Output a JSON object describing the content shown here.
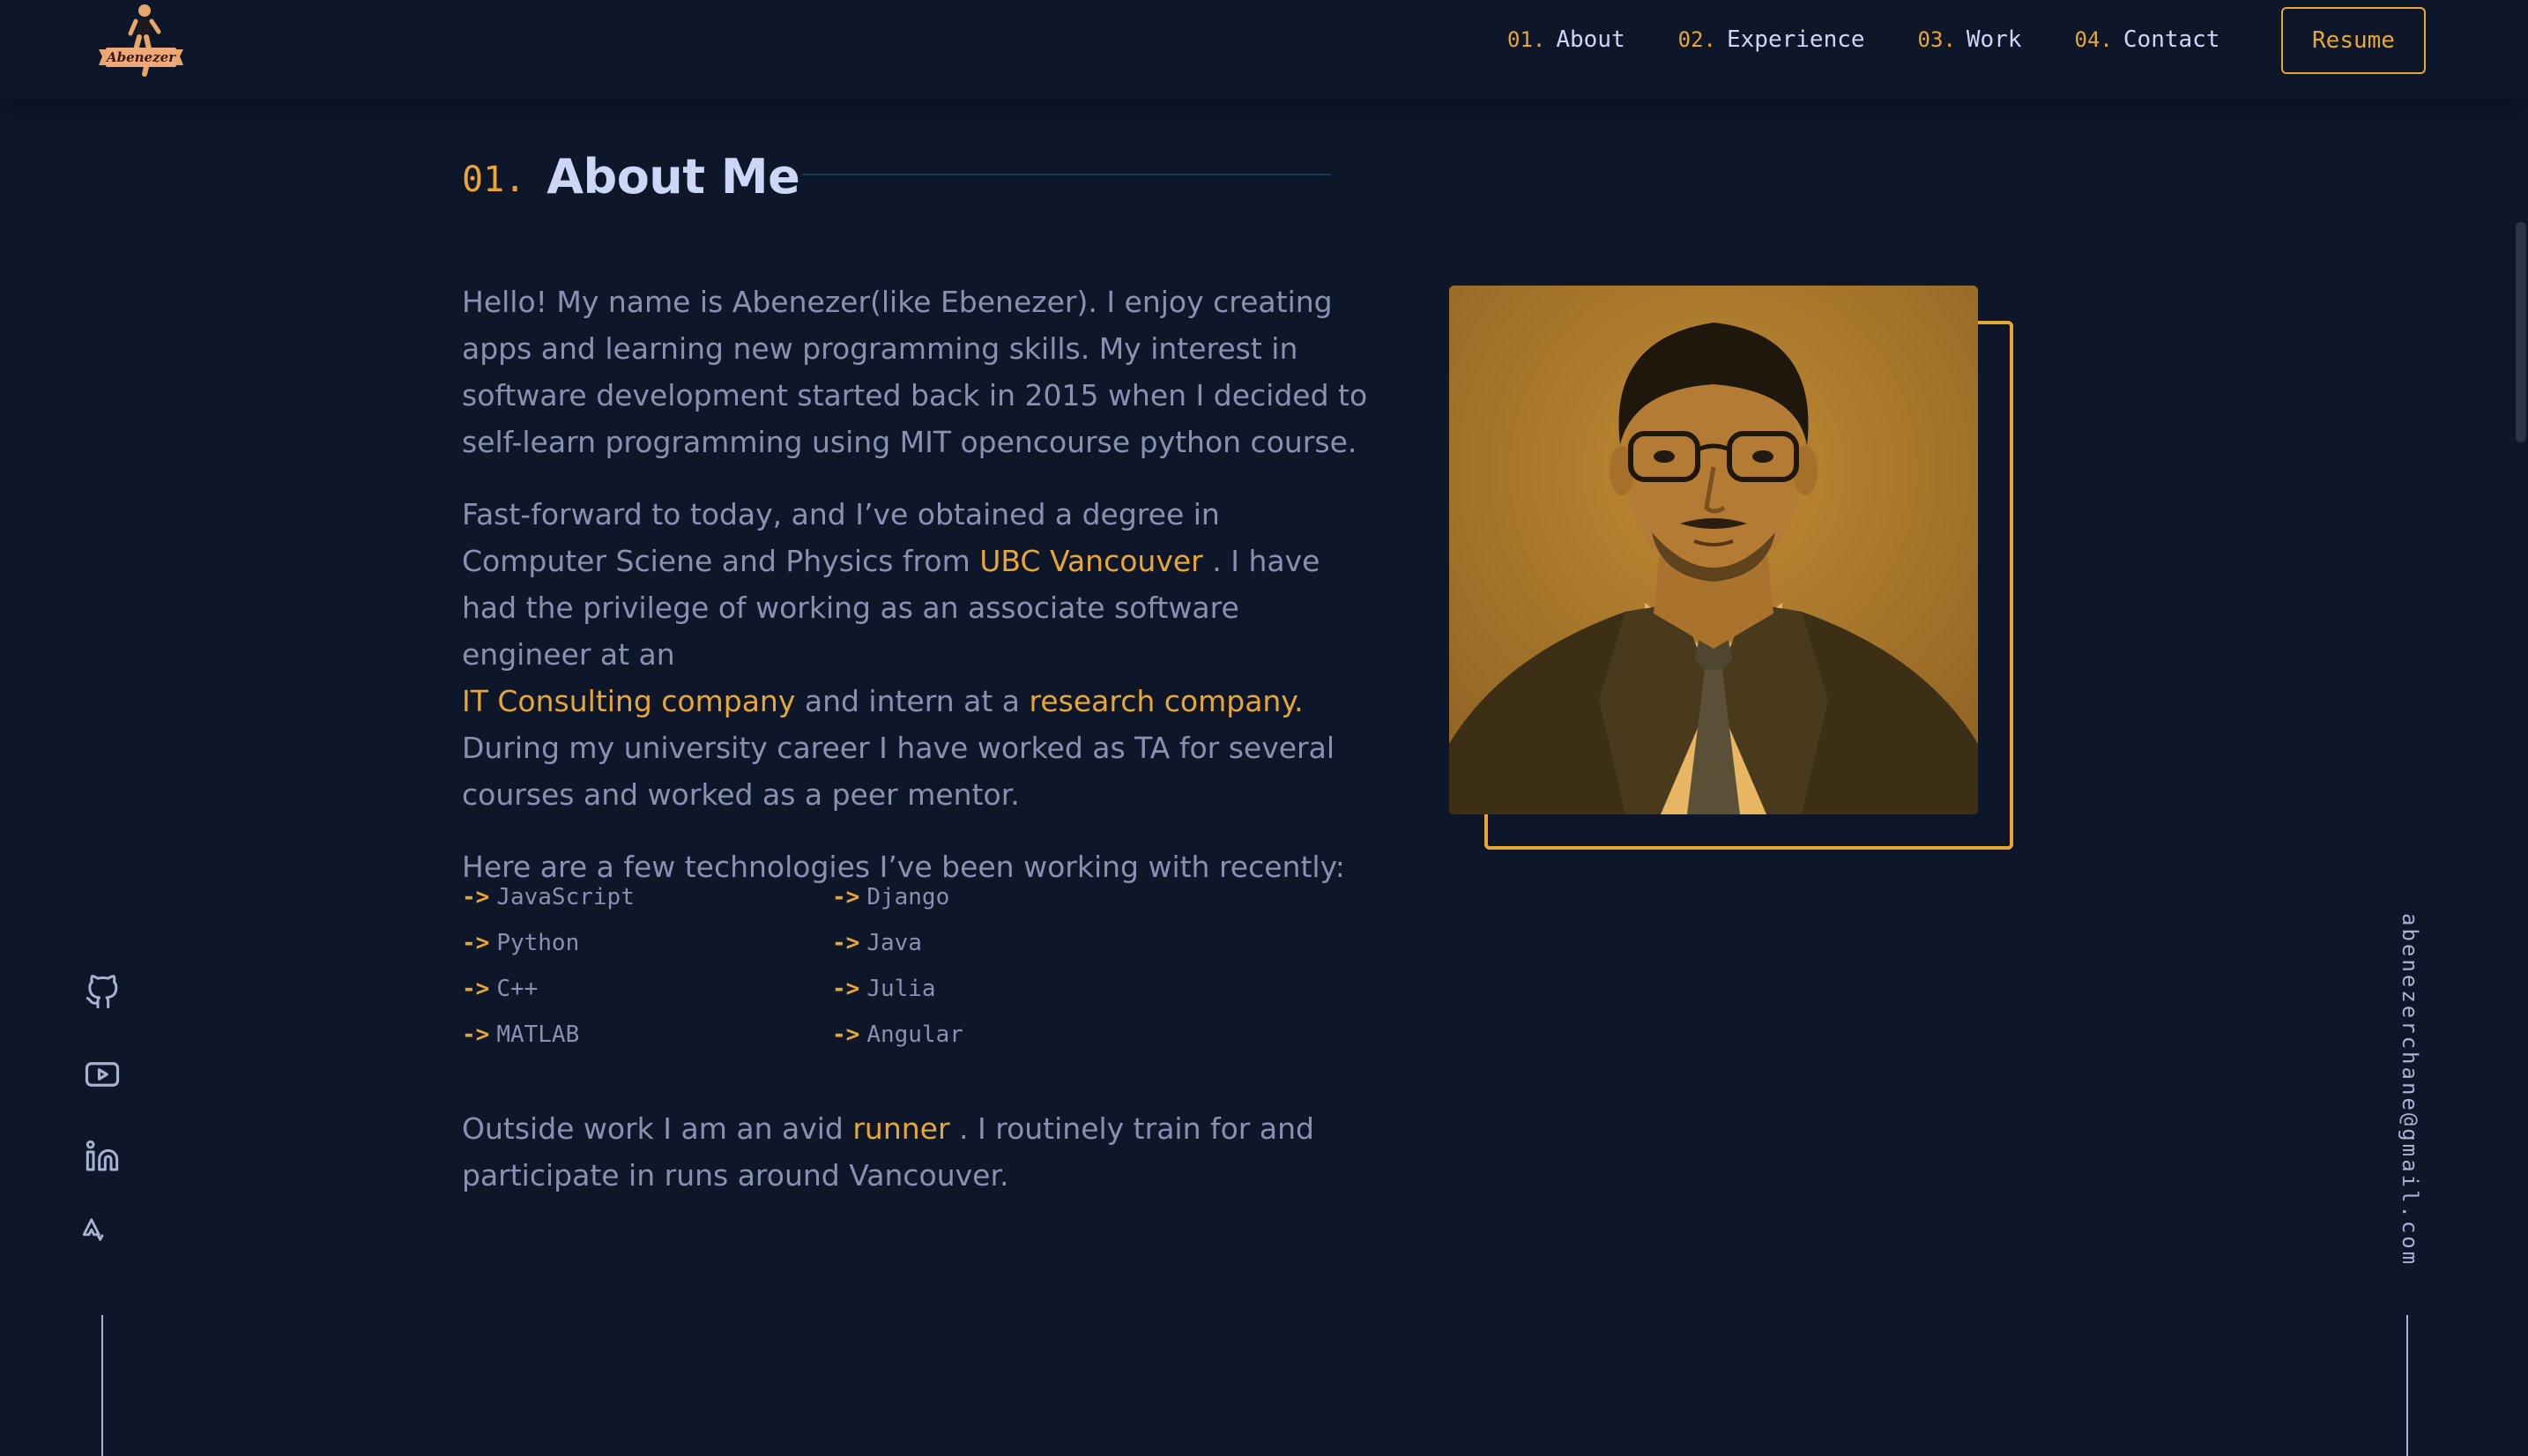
{
  "header": {
    "logo_text": "Abenezer",
    "nav": [
      {
        "num": "01.",
        "label": "About"
      },
      {
        "num": "02.",
        "label": "Experience"
      },
      {
        "num": "03.",
        "label": "Work"
      },
      {
        "num": "04.",
        "label": "Contact"
      }
    ],
    "resume_label": "Resume"
  },
  "about": {
    "heading_num": "01.",
    "heading_title": "About Me",
    "p1": "Hello! My name is Abenezer(like Ebenezer). I enjoy creating apps and learning new programming skills. My interest in software development started back in 2015 when I decided to self-learn programming using MIT opencourse python course.",
    "p2_a": "Fast-forward to today, and I’ve obtained a degree in Computer Sciene and Physics from ",
    "p2_link1": "UBC Vancouver",
    "p2_b": " . I have had the privilege of working as an associate software engineer at an ",
    "p2_link2": "IT Consulting company",
    "p2_c": " and intern at a ",
    "p2_link3": "research company.",
    "p2_d": " During my university career I have worked as TA for several courses and worked as a peer mentor.",
    "p3": "Here are a few technologies I’ve been working with recently:",
    "arrow": "->",
    "technologies": [
      "JavaScript",
      "Django",
      "Python",
      "Java",
      "C++",
      "Julia",
      "MATLAB",
      "Angular"
    ],
    "outside_a": "Outside work I am an avid ",
    "outside_link": "runner",
    "outside_b": " . I routinely train for and participate in runs around Vancouver."
  },
  "sidebar": {
    "email": "abenezerchane@gmail.com",
    "socials": [
      "github-icon",
      "youtube-icon",
      "linkedin-icon",
      "strava-icon"
    ]
  },
  "colors": {
    "background": "#0e172a",
    "accent": "#e8a634",
    "text": "#8892b0",
    "heading": "#ccd6f6"
  }
}
